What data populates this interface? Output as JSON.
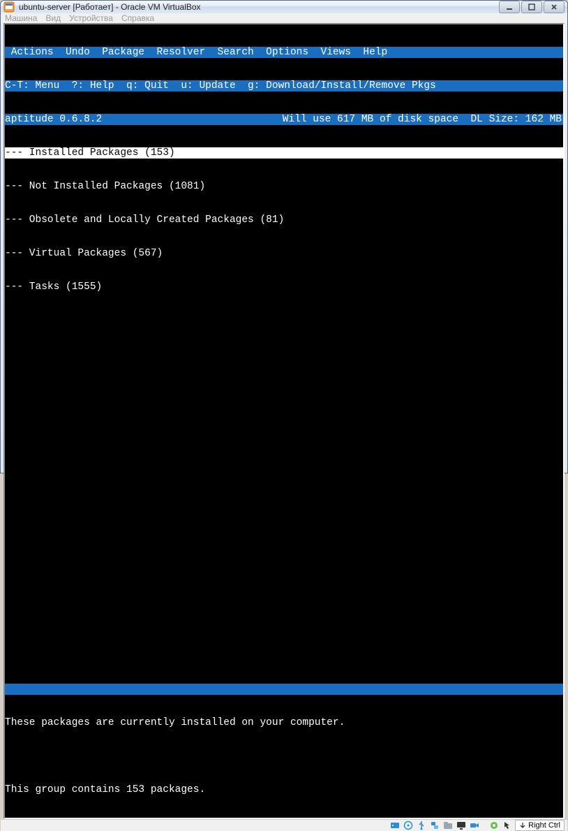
{
  "window": {
    "title": "ubuntu-server [Работает] - Oracle VM VirtualBox"
  },
  "host_menu": {
    "machine": "Машина",
    "view": "Вид",
    "devices": "Устройства",
    "help": "Справка"
  },
  "aptitude": {
    "menu_row": " Actions  Undo  Package  Resolver  Search  Options  Views  Help",
    "help_row": "C-T: Menu  ?: Help  q: Quit  u: Update  g: Download/Install/Remove Pkgs",
    "status_left": "aptitude 0.6.8.2",
    "status_right": "Will use 617 MB of disk space  DL Size: 162 MB",
    "groups": {
      "installed": "--- Installed Packages (153)",
      "not_installed": "--- Not Installed Packages (1081)",
      "obsolete": "--- Obsolete and Locally Created Packages (81)",
      "virtual": "--- Virtual Packages (567)",
      "tasks": "--- Tasks (1555)"
    },
    "desc_line1": "These packages are currently installed on your computer.",
    "desc_line2": "This group contains 153 packages."
  },
  "statusbar": {
    "hostkey": "Right Ctrl"
  }
}
